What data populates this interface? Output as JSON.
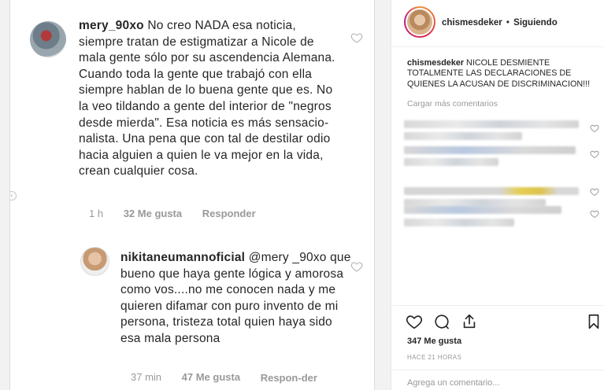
{
  "left": {
    "comment1": {
      "username": "mery_90xo",
      "text": "No creo NADA esa noticia, siempre tratan de estigmatizar a Nicole de mala gente sólo por su ascendencia Alemana. Cuando toda la gente que trabajó con ella siempre hablan de lo buena gente que es. No la veo tildando a gente del interior de \"negros desde mierda\". Esa noticia es más sensacio-nalista. Una pena que con tal de destilar odio hacia alguien a quien le va mejor en la vida, crean cualquier cosa.",
      "time": "1 h",
      "likes": "32 Me gusta",
      "reply": "Responder"
    },
    "comment2": {
      "username": "nikitaneumannoficial",
      "text": "@mery _90xo que bueno que haya gente lógica y amorosa como vos....no me conocen nada y me quieren difamar con puro invento de mi persona, tristeza total quien haya sido esa mala persona",
      "time": "37 min",
      "likes": "47 Me gusta",
      "reply": "Respon-der"
    }
  },
  "right": {
    "header": {
      "username": "chismesdeker",
      "separator": "•",
      "status": "Siguiendo"
    },
    "caption": {
      "username": "chismesdeker",
      "text": "NICOLE DESMIENTE TOTALMENTE LAS DECLARACIONES DE QUIENES LA ACUSAN DE DISCRIMINACION!!!"
    },
    "load_more": "Cargar más comentarios",
    "likes": "347 Me gusta",
    "time": "HACE 21 HORAS",
    "add_comment_placeholder": "Agrega un comentario..."
  },
  "icons": {
    "comment_like": "heart-outline-icon",
    "post_like": "heart-outline-icon",
    "comment": "speech-bubble-icon",
    "share": "share-icon",
    "save": "bookmark-icon"
  }
}
